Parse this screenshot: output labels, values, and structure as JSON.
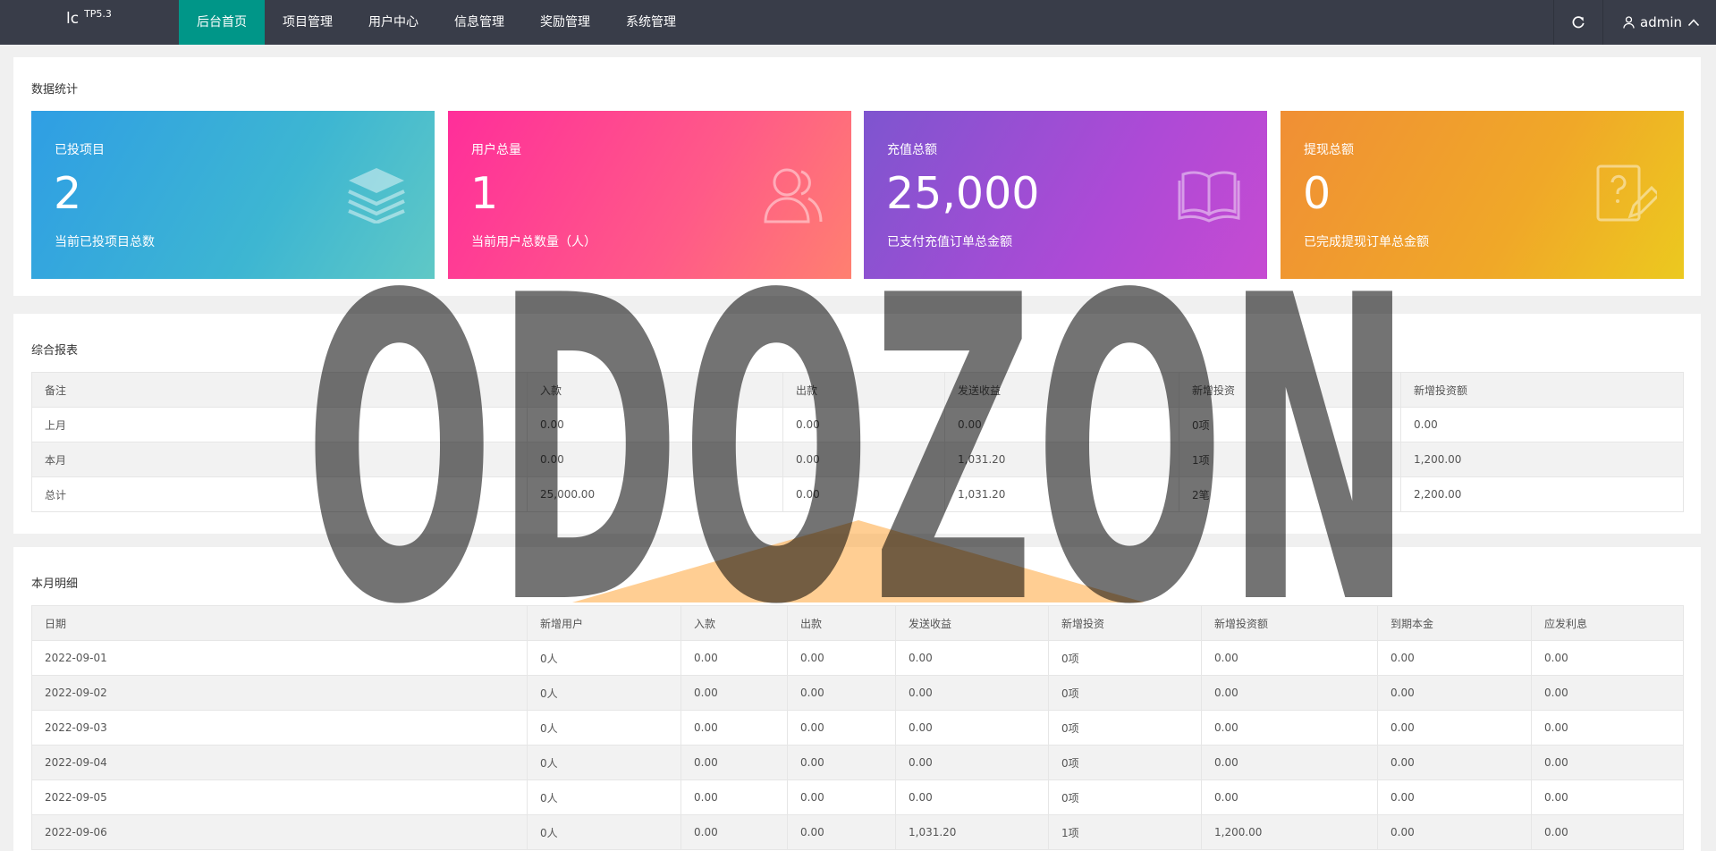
{
  "app": {
    "logo": "lc",
    "version": "TP5.3"
  },
  "nav": [
    "后台首页",
    "项目管理",
    "用户中心",
    "信息管理",
    "奖励管理",
    "系统管理"
  ],
  "user": {
    "name": "admin"
  },
  "stats": {
    "title": "数据统计",
    "cards": [
      {
        "label": "已投项目",
        "value": "2",
        "desc": "当前已投项目总数",
        "icon": "layers-icon"
      },
      {
        "label": "用户总量",
        "value": "1",
        "desc": "当前用户总数量（人）",
        "icon": "users-icon"
      },
      {
        "label": "充值总额",
        "value": "25,000",
        "desc": "已支付充值订单总金额",
        "icon": "book-icon"
      },
      {
        "label": "提现总额",
        "value": "0",
        "desc": "已完成提现订单总金额",
        "icon": "edit-icon"
      }
    ]
  },
  "report": {
    "title": "综合报表",
    "headers": [
      "备注",
      "入款",
      "出款",
      "发送收益",
      "新增投资",
      "新增投资额"
    ],
    "rows": [
      [
        "上月",
        "0.00",
        "0.00",
        "0.00",
        "0项",
        "0.00"
      ],
      [
        "本月",
        "0.00",
        "0.00",
        "1,031.20",
        "1项",
        "1,200.00"
      ],
      [
        "总计",
        "25,000.00",
        "0.00",
        "1,031.20",
        "2笔",
        "2,200.00"
      ]
    ]
  },
  "detail": {
    "title": "本月明细",
    "headers": [
      "日期",
      "新增用户",
      "入款",
      "出款",
      "发送收益",
      "新增投资",
      "新增投资额",
      "到期本金",
      "应发利息"
    ],
    "rows": [
      [
        "2022-09-01",
        "0人",
        "0.00",
        "0.00",
        "0.00",
        "0项",
        "0.00",
        "0.00",
        "0.00"
      ],
      [
        "2022-09-02",
        "0人",
        "0.00",
        "0.00",
        "0.00",
        "0项",
        "0.00",
        "0.00",
        "0.00"
      ],
      [
        "2022-09-03",
        "0人",
        "0.00",
        "0.00",
        "0.00",
        "0项",
        "0.00",
        "0.00",
        "0.00"
      ],
      [
        "2022-09-04",
        "0人",
        "0.00",
        "0.00",
        "0.00",
        "0项",
        "0.00",
        "0.00",
        "0.00"
      ],
      [
        "2022-09-05",
        "0人",
        "0.00",
        "0.00",
        "0.00",
        "0项",
        "0.00",
        "0.00",
        "0.00"
      ],
      [
        "2022-09-06",
        "0人",
        "0.00",
        "0.00",
        "1,031.20",
        "1项",
        "1,200.00",
        "0.00",
        "0.00"
      ]
    ]
  },
  "watermark": {
    "text": "ODOZON",
    "color": "#000000",
    "accent": "#ffa53a"
  }
}
